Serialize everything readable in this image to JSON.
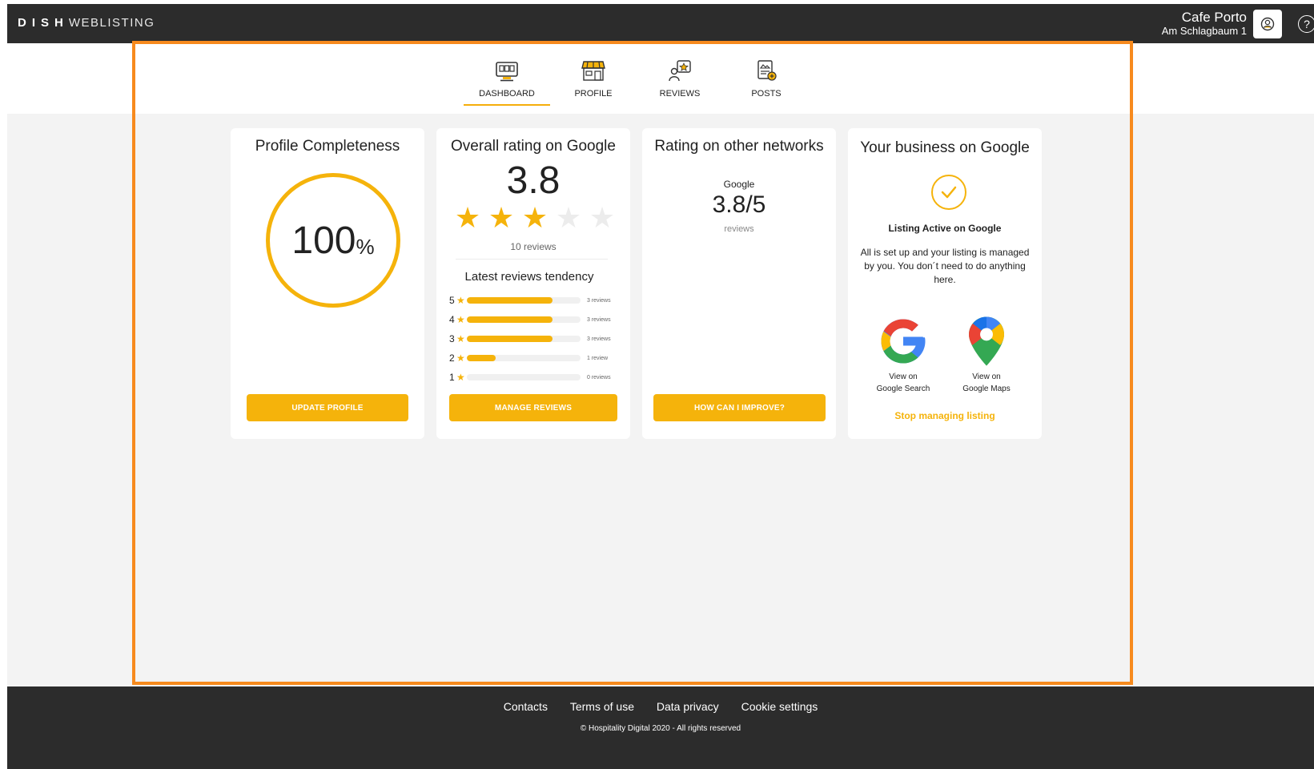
{
  "topbar": {
    "logo_main": "DISH",
    "logo_sub": "WEBLISTING",
    "business_name": "Cafe Porto",
    "business_address": "Am Schlagbaum 1",
    "help_glyph": "?"
  },
  "nav": {
    "items": [
      {
        "label": "DASHBOARD",
        "icon": "monitor-icon",
        "active": true
      },
      {
        "label": "PROFILE",
        "icon": "storefront-icon",
        "active": false
      },
      {
        "label": "REVIEWS",
        "icon": "review-star-icon",
        "active": false
      },
      {
        "label": "POSTS",
        "icon": "post-add-icon",
        "active": false
      }
    ]
  },
  "profile_card": {
    "title": "Profile Completeness",
    "value": "100",
    "unit": "%",
    "button": "UPDATE PROFILE"
  },
  "google_rating_card": {
    "title": "Overall rating on Google",
    "rating": "3.8",
    "stars_filled": 3,
    "stars_total": 5,
    "reviews_count": "10 reviews",
    "tendency_title": "Latest reviews tendency",
    "bars": [
      {
        "stars": "5",
        "fraction": 0.75,
        "label": "3 reviews"
      },
      {
        "stars": "4",
        "fraction": 0.75,
        "label": "3 reviews"
      },
      {
        "stars": "3",
        "fraction": 0.75,
        "label": "3 reviews"
      },
      {
        "stars": "2",
        "fraction": 0.25,
        "label": "1 review"
      },
      {
        "stars": "1",
        "fraction": 0,
        "label": "0 reviews"
      }
    ],
    "button": "MANAGE REVIEWS"
  },
  "networks_card": {
    "title": "Rating on other networks",
    "network": "Google",
    "rating": "3.8/5",
    "sub": "reviews",
    "button": "HOW CAN I IMPROVE?"
  },
  "business_card": {
    "title": "Your business on Google",
    "status_title": "Listing Active on Google",
    "status_desc": "All is set up and your listing is managed by you. You don´t need to do anything here.",
    "search_label_1": "View on",
    "search_label_2": "Google Search",
    "maps_label_1": "View on",
    "maps_label_2": "Google Maps",
    "stop_link": "Stop managing listing"
  },
  "footer": {
    "links": [
      "Contacts",
      "Terms of use",
      "Data privacy",
      "Cookie settings"
    ],
    "copyright": "© Hospitality Digital 2020 - All rights reserved"
  },
  "colors": {
    "accent": "#f5b30b",
    "highlight": "#f78a1d",
    "dark": "#2c2c2c"
  }
}
